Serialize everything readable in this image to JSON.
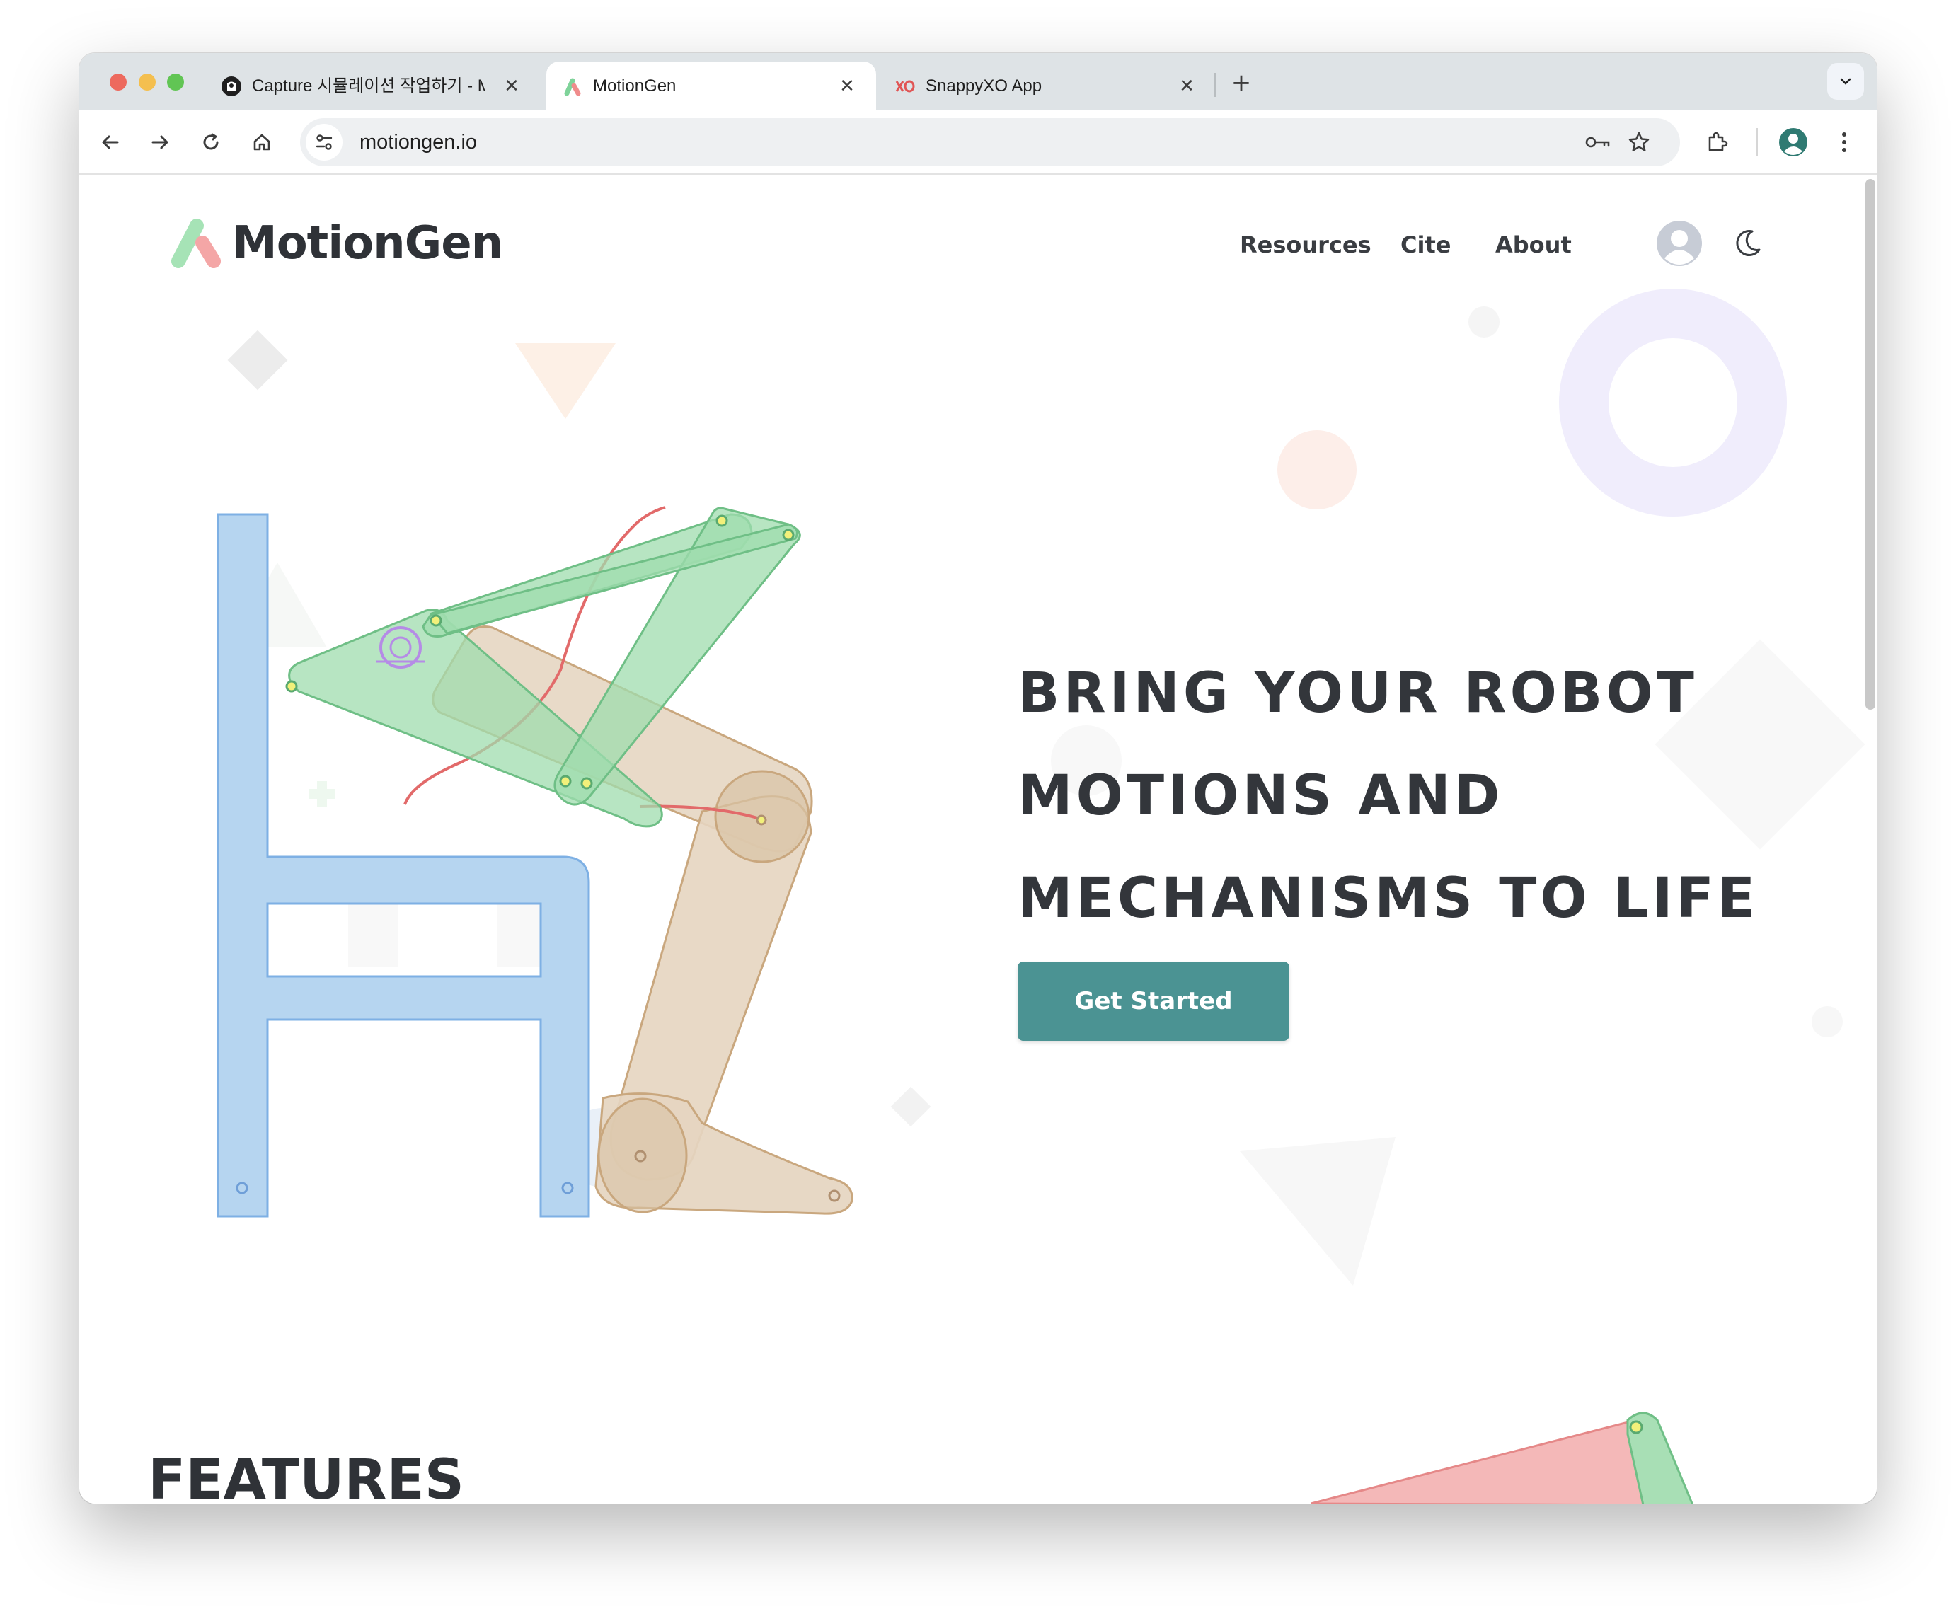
{
  "browser": {
    "tabs": [
      {
        "title": "Capture 시뮬레이션 작업하기 - M",
        "favicon": "notion-icon",
        "active": false
      },
      {
        "title": "MotionGen",
        "favicon": "motiongen-icon",
        "active": true
      },
      {
        "title": "SnappyXO App",
        "favicon": "snappyxo-icon",
        "active": false
      }
    ],
    "new_tab_symbol": "+",
    "close_symbol": "✕",
    "address": "motiongen.io"
  },
  "site": {
    "logo_text": "MotionGen",
    "nav": [
      {
        "label": "Resources"
      },
      {
        "label": "Cite"
      },
      {
        "label": "About"
      }
    ],
    "hero_lines": [
      "BRING YOUR ROBOT",
      "MOTIONS AND",
      "MECHANISMS TO LIFE"
    ],
    "cta_label": "Get Started",
    "features_heading": "FEATURES"
  },
  "colors": {
    "brand_green": "#7fd39a",
    "brand_red": "#f08c8c",
    "cta": "#4b9393",
    "chair_blue": "#b6d5f0",
    "leg_tan": "#e5d5c0",
    "linkage_green": "#9fdcae"
  }
}
